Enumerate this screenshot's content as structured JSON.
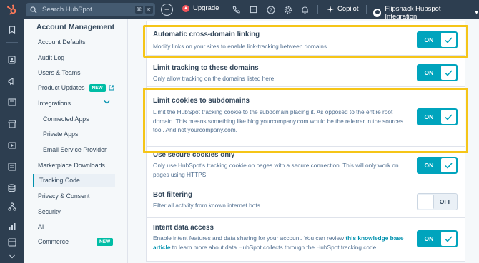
{
  "topbar": {
    "search_placeholder": "Search HubSpot",
    "kbd_keys": [
      "⌘",
      "K"
    ],
    "upgrade_label": "Upgrade",
    "copilot_label": "Copilot",
    "account_name": "Flipsnack Hubspot Integration"
  },
  "sidebar": {
    "title": "Account Management",
    "items": [
      {
        "label": "Account Defaults"
      },
      {
        "label": "Audit Log"
      },
      {
        "label": "Users & Teams"
      },
      {
        "label": "Product Updates",
        "badge": "NEW"
      },
      {
        "label": "Integrations"
      },
      {
        "label": "Connected Apps"
      },
      {
        "label": "Private Apps"
      },
      {
        "label": "Email Service Provider"
      },
      {
        "label": "Marketplace Downloads"
      },
      {
        "label": "Tracking Code"
      },
      {
        "label": "Privacy & Consent"
      },
      {
        "label": "Security"
      },
      {
        "label": "AI"
      },
      {
        "label": "Commerce",
        "badge": "NEW"
      }
    ]
  },
  "settings": [
    {
      "title": "Automatic cross-domain linking",
      "desc": "Modify links on your sites to enable link-tracking between domains.",
      "state": "ON"
    },
    {
      "title": "Limit tracking to these domains",
      "desc": "Only allow tracking on the domains listed here.",
      "state": "ON"
    },
    {
      "title": "Limit cookies to subdomains",
      "desc": "Limit the HubSpot tracking cookie to the subdomain placing it. As opposed to the entire root domain. This means something like blog.yourcompany.com would be the referrer in the sources tool. And not yourcompany.com.",
      "state": "ON"
    },
    {
      "title": "Use secure cookies only",
      "desc": "Only use HubSpot's tracking cookie on pages with a secure connection. This will only work on pages using HTTPS.",
      "state": "ON"
    },
    {
      "title": "Bot filtering",
      "desc": "Filter all activity from known internet bots.",
      "state": "OFF"
    },
    {
      "title": "Intent data access",
      "desc_before": "Enable intent features and data sharing for your account. You can review ",
      "desc_link": "this knowledge base article",
      "desc_after": " to learn more about data HubSpot collects through the HubSpot tracking code.",
      "state": "ON"
    }
  ],
  "colors": {
    "accent": "#00a4bd",
    "highlight": "#f5c518",
    "nav_bg": "#2d3e50",
    "new_badge": "#00bda5"
  }
}
